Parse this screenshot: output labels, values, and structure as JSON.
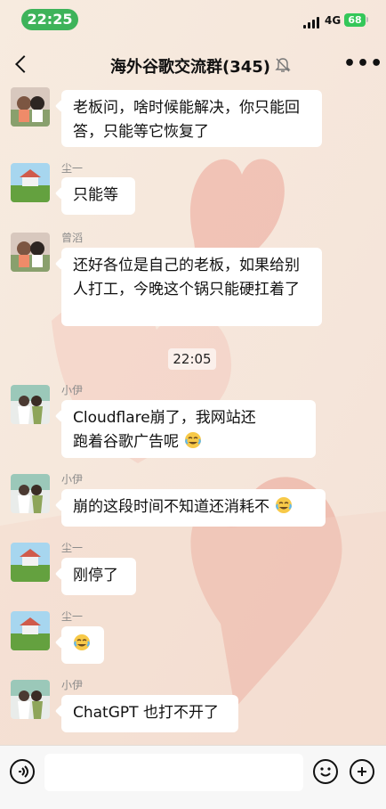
{
  "status": {
    "time": "22:25",
    "network": "4G",
    "battery": "68"
  },
  "header": {
    "title": "海外谷歌交流群(345)"
  },
  "time_separator": "22:05",
  "messages": [
    {
      "sender": "",
      "text": "老板问，啥时候能解决，你只能回答，只能等它恢复了",
      "avatar": "couple-photo"
    },
    {
      "sender": "尘一",
      "text": "只能等",
      "avatar": "landscape-photo"
    },
    {
      "sender": "曾滔",
      "text": "还好各位是自己的老板，如果给别人打工，今晚这个锅只能硬扛着了",
      "avatar": "couple-photo"
    },
    {
      "sender": "小伊",
      "text": "Cloudflare崩了，我网站还跑着谷歌广告呢",
      "avatar": "wedding-photo"
    },
    {
      "sender": "小伊",
      "text": "崩的这段时间不知道还消耗不",
      "avatar": "wedding-photo"
    },
    {
      "sender": "尘一",
      "text": "刚停了",
      "avatar": "landscape-photo"
    },
    {
      "sender": "尘一",
      "text": "",
      "avatar": "landscape-photo"
    },
    {
      "sender": "小伊",
      "text": "ChatGPT 也打不开了",
      "avatar": "wedding-photo"
    }
  ],
  "input": {
    "placeholder": ""
  },
  "icons": {
    "back": "chevron-left-icon",
    "mute": "bell-slash-icon",
    "more": "more-dots-icon",
    "voice": "voice-icon",
    "emoji": "smile-icon",
    "plus": "plus-icon",
    "bubble_emoji": "laugh-cry-emoji-icon"
  },
  "colors": {
    "status_pill": "#3eb35a",
    "battery": "#34c759",
    "background": "#f3e6dc",
    "heart": "#e67a6b",
    "bubble": "#ffffff",
    "input_bar": "#f7f7f7"
  }
}
